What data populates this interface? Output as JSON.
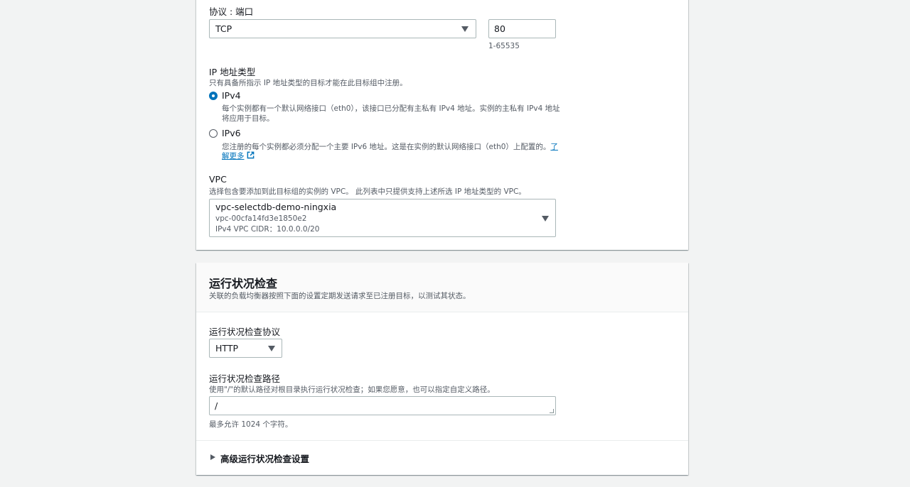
{
  "target_group": {
    "protocol_port_label": "协议 : 端口",
    "protocol_value": "TCP",
    "port_value": "80",
    "port_hint": "1-65535",
    "ip_type": {
      "label": "IP 地址类型",
      "description": "只有具备所指示 IP 地址类型的目标才能在此目标组中注册。",
      "options": [
        {
          "label": "IPv4",
          "checked": true,
          "desc_line1": "每个实例都有一个默认网络接口（eth0），该接口已分配有主私有 IPv4 地址。实例的主私有 IPv4 地址",
          "desc_line2": "将应用于目标。"
        },
        {
          "label": "IPv6",
          "checked": false,
          "desc_line1": "您注册的每个实例都必须分配一个主要 IPv6 地址。这是在实例的默认网络接口（eth0）上配置的。",
          "link_part1": "了",
          "link_part2": "解更多"
        }
      ]
    },
    "vpc": {
      "label": "VPC",
      "description": "选择包含要添加到此目标组的实例的 VPC。 此列表中只提供支持上述所选 IP 地址类型的 VPC。",
      "name": "vpc-selectdb-demo-ningxia",
      "id": "vpc-00cfa14fd3e1850e2",
      "cidr": "IPv4 VPC CIDR：10.0.0.0/20"
    }
  },
  "health_check": {
    "title": "运行状况检查",
    "description": "关联的负载均衡器按照下面的设置定期发送请求至已注册目标，以测试其状态。",
    "protocol_label": "运行状况检查协议",
    "protocol_value": "HTTP",
    "path_label": "运行状况检查路径",
    "path_description": "使用\"/\"的默认路径对根目录执行运行状况检查；如果您愿意，也可以指定自定义路径。",
    "path_value": "/",
    "path_hint": "最多允许 1024 个字符。",
    "advanced_label": "高级运行状况检查设置"
  },
  "colors": {
    "page_bg": "#f2f3f3",
    "link": "#0073bb",
    "radio_selected": "#0073bb",
    "text_primary": "#16191f",
    "text_secondary": "#545b64",
    "border": "#aab7b8"
  },
  "icons": {
    "dropdown": "caret-down-icon",
    "external_link": "external-link-icon",
    "expand": "caret-right-icon"
  }
}
